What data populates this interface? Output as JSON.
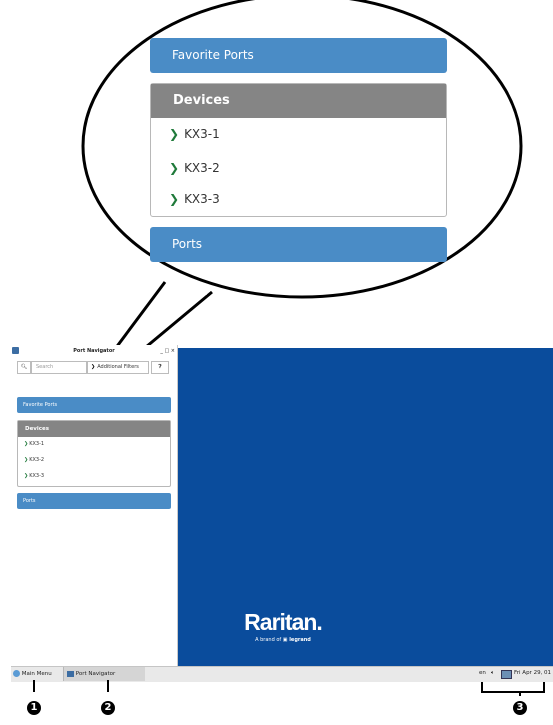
{
  "zoom": {
    "favorite_ports": "Favorite Ports",
    "devices_header": "Devices",
    "devices": [
      "KX3-1",
      "KX3-2",
      "KX3-3"
    ],
    "ports": "Ports"
  },
  "window": {
    "title": "Port Navigator",
    "controls": "_ □ ×",
    "search_placeholder": "Search",
    "filters_label": "Additional Filters",
    "favorite_ports": "Favorite Ports",
    "devices_header": "Devices",
    "devices": [
      "KX3-1",
      "KX3-2",
      "KX3-3"
    ],
    "ports": "Ports"
  },
  "desktop": {
    "brand": "Raritan.",
    "tagline_prefix": "A brand of",
    "tagline_brand": "legrand"
  },
  "taskbar": {
    "main_menu": "Main Menu",
    "port_navigator": "Port Navigator",
    "lang": "en",
    "datetime": "Fri Apr 29, 01"
  },
  "callouts": [
    "1",
    "2",
    "3"
  ],
  "colors": {
    "accent": "#4a8cc6",
    "header_gray": "#858585",
    "desktop_bg": "#0a4c9c",
    "chevron": "#1f7a3a"
  }
}
